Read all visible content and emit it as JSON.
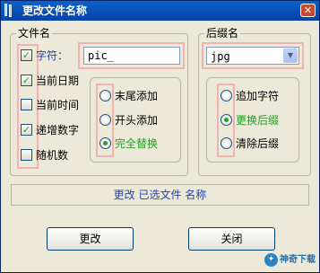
{
  "window": {
    "title": "更改文件名称",
    "close_glyph": "✕"
  },
  "filename_group": {
    "title": "文件名",
    "checkboxes": [
      {
        "label": "字符：",
        "checked": true
      },
      {
        "label": "当前日期",
        "checked": true
      },
      {
        "label": "当前时间",
        "checked": false
      },
      {
        "label": "递增数字",
        "checked": true
      },
      {
        "label": "随机数",
        "checked": false
      }
    ],
    "text_input_value": "pic_",
    "radios": [
      {
        "label": "末尾添加",
        "selected": false
      },
      {
        "label": "开头添加",
        "selected": false
      },
      {
        "label": "完全替换",
        "selected": true
      }
    ]
  },
  "extension_group": {
    "title": "后缀名",
    "select_value": "jpg",
    "radios": [
      {
        "label": "追加字符",
        "selected": false
      },
      {
        "label": "更换后缀",
        "selected": true
      },
      {
        "label": "清除后缀",
        "selected": false
      }
    ]
  },
  "status_text": "更改  已选文件  名称",
  "buttons": {
    "ok": "更改",
    "close": "关闭"
  },
  "watermark": {
    "text": "神奇下载"
  },
  "colors": {
    "accent_green": "#21a121",
    "highlight_pink": "#f3b2b2",
    "title_blue": "#0a62c8",
    "status_text_blue": "#2046b0"
  }
}
